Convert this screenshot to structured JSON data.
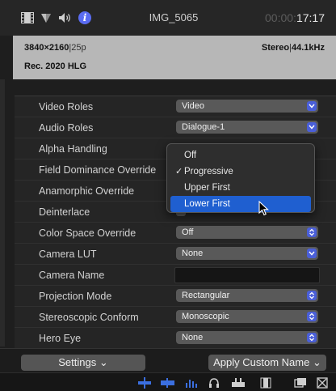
{
  "header": {
    "clip_name": "IMG_5065",
    "timecode_dim": "00:00:",
    "timecode_bright": "17:17"
  },
  "summary": {
    "resolution": "3840×2160",
    "frame_rate": "25p",
    "audio_channels": "Stereo",
    "sample_rate": "44.1kHz",
    "color_space": "Rec. 2020 HLG"
  },
  "settings": {
    "rows": [
      {
        "label": "Video Roles",
        "value": "Video"
      },
      {
        "label": "Audio Roles",
        "value": "Dialogue-1"
      },
      {
        "label": "Alpha Handling",
        "value": ""
      },
      {
        "label": "Field Dominance Override",
        "value": ""
      },
      {
        "label": "Anamorphic Override",
        "value": ""
      },
      {
        "label": "Deinterlace",
        "value": ""
      },
      {
        "label": "Color Space Override",
        "value": "Off"
      },
      {
        "label": "Camera LUT",
        "value": "None"
      },
      {
        "label": "Camera Name",
        "value": ""
      },
      {
        "label": "Projection Mode",
        "value": "Rectangular"
      },
      {
        "label": "Stereoscopic Conform",
        "value": "Monoscopic"
      },
      {
        "label": "Hero Eye",
        "value": "None"
      }
    ]
  },
  "menu": {
    "items": [
      "Off",
      "Progressive",
      "Upper First",
      "Lower First"
    ],
    "checked": "Progressive",
    "highlighted": "Lower First",
    "check_glyph": "✓"
  },
  "footer": {
    "settings_label": "Settings ⌄",
    "apply_label": "Apply Custom Name ⌄"
  },
  "colors": {
    "accent": "#4a5fd9",
    "menu_highlight": "#1f5fd0",
    "summary_bg": "#b7b7b7"
  }
}
